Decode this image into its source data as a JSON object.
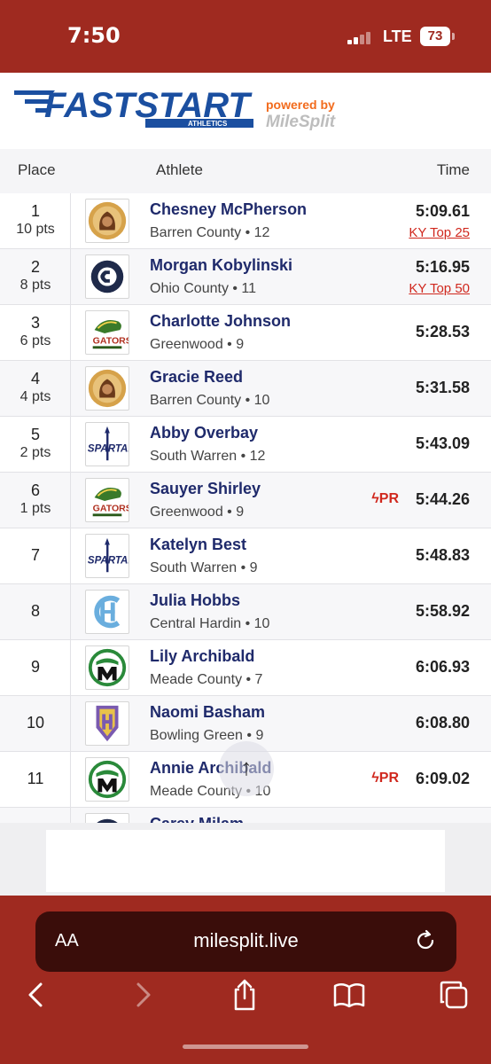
{
  "status": {
    "time": "7:50",
    "network": "LTE",
    "battery": "73"
  },
  "brand": {
    "logo_text": "FASTSTART",
    "logo_sub": "ATHLETICS",
    "powered_by": "powered by",
    "powered_brand": "MileSplit"
  },
  "table": {
    "headers": {
      "place": "Place",
      "athlete": "Athlete",
      "time": "Time"
    },
    "rows": [
      {
        "place": "1",
        "pts": "10 pts",
        "name": "Chesney McPherson",
        "school": "Barren County • 12",
        "time": "5:09.61",
        "rank": "KY Top 25",
        "pr": "",
        "logo": "barren"
      },
      {
        "place": "2",
        "pts": "8 pts",
        "name": "Morgan Kobylinski",
        "school": "Ohio County • 11",
        "time": "5:16.95",
        "rank": "KY Top 50",
        "pr": "",
        "logo": "ohio"
      },
      {
        "place": "3",
        "pts": "6 pts",
        "name": "Charlotte Johnson",
        "school": "Greenwood • 9",
        "time": "5:28.53",
        "rank": "",
        "pr": "",
        "logo": "gators"
      },
      {
        "place": "4",
        "pts": "4 pts",
        "name": "Gracie Reed",
        "school": "Barren County • 10",
        "time": "5:31.58",
        "rank": "",
        "pr": "",
        "logo": "barren"
      },
      {
        "place": "5",
        "pts": "2 pts",
        "name": "Abby Overbay",
        "school": "South Warren • 12",
        "time": "5:43.09",
        "rank": "",
        "pr": "",
        "logo": "spartans"
      },
      {
        "place": "6",
        "pts": "1 pts",
        "name": "Sauyer Shirley",
        "school": "Greenwood • 9",
        "time": "5:44.26",
        "rank": "",
        "pr": "PR",
        "logo": "gators"
      },
      {
        "place": "7",
        "pts": "",
        "name": "Katelyn Best",
        "school": "South Warren • 9",
        "time": "5:48.83",
        "rank": "",
        "pr": "",
        "logo": "spartans"
      },
      {
        "place": "8",
        "pts": "",
        "name": "Julia Hobbs",
        "school": "Central Hardin • 10",
        "time": "5:58.92",
        "rank": "",
        "pr": "",
        "logo": "hardin"
      },
      {
        "place": "9",
        "pts": "",
        "name": "Lily Archibald",
        "school": "Meade County • 7",
        "time": "6:06.93",
        "rank": "",
        "pr": "",
        "logo": "meade"
      },
      {
        "place": "10",
        "pts": "",
        "name": "Naomi Basham",
        "school": "Bowling Green • 9",
        "time": "6:08.80",
        "rank": "",
        "pr": "",
        "logo": "bowling"
      },
      {
        "place": "11",
        "pts": "",
        "name": "Annie Archibald",
        "school": "Meade County • 10",
        "time": "6:09.02",
        "rank": "",
        "pr": "PR",
        "logo": "meade"
      },
      {
        "place": "",
        "pts": "",
        "name": "Carey Milam",
        "school": "",
        "time": "",
        "rank": "",
        "pr": "",
        "logo": "ohio"
      }
    ]
  },
  "browser": {
    "aa_label": "AA",
    "url": "milesplit.live"
  },
  "colors": {
    "chrome_red": "#9f2a20",
    "name_navy": "#1f2a6b",
    "link_red": "#d0281e",
    "brand_blue": "#1b4fa0",
    "brand_orange": "#f26b1d"
  }
}
